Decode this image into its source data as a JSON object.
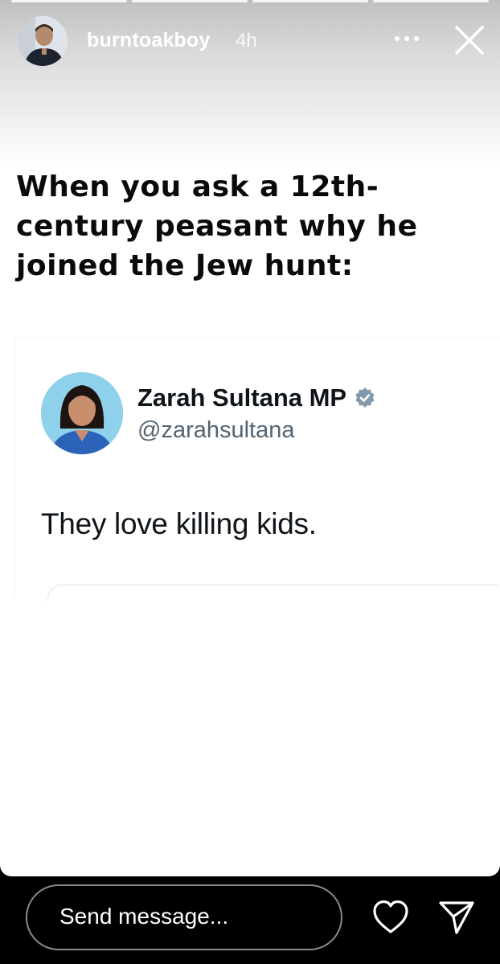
{
  "story": {
    "progress_segments": 4,
    "username": "burntoakboy",
    "time_ago": "4h",
    "icons": {
      "more": "more-horizontal-icon",
      "close": "close-icon"
    }
  },
  "meme": {
    "text": "When you ask a 12th-century peasant why he joined the Jew hunt:"
  },
  "tweet": {
    "display_name": "Zarah Sultana MP",
    "handle": "@zarahsultana",
    "verified": true,
    "text": "They love killing kids."
  },
  "bottom_bar": {
    "message_label": "Send message...",
    "icons": {
      "like": "heart-icon",
      "share": "send-icon"
    }
  }
}
